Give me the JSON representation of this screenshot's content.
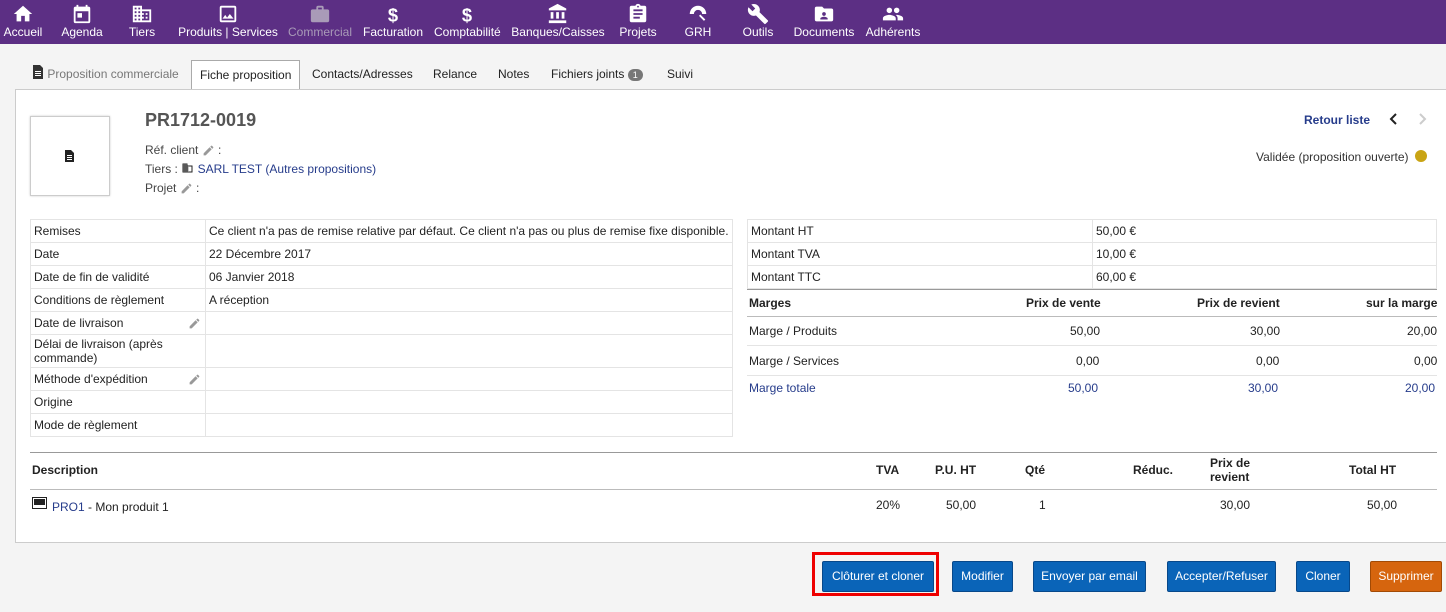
{
  "topnav": [
    {
      "label": "Accueil",
      "icon": "home-icon"
    },
    {
      "label": "Agenda",
      "icon": "calendar-icon"
    },
    {
      "label": "Tiers",
      "icon": "building-icon"
    },
    {
      "label": "Produits | Services",
      "icon": "image-icon"
    },
    {
      "label": "Commercial",
      "icon": "briefcase-icon"
    },
    {
      "label": "Facturation",
      "icon": "dollar-icon"
    },
    {
      "label": "Comptabilité",
      "icon": "dollar-icon"
    },
    {
      "label": "Banques/Caisses",
      "icon": "bank-icon"
    },
    {
      "label": "Projets",
      "icon": "clipboard-icon"
    },
    {
      "label": "GRH",
      "icon": "umbrella-icon"
    },
    {
      "label": "Outils",
      "icon": "wrench-icon"
    },
    {
      "label": "Documents",
      "icon": "folder-icon"
    },
    {
      "label": "Adhérents",
      "icon": "people-icon"
    }
  ],
  "tabs": {
    "t0": "Proposition commerciale",
    "t1": "Fiche proposition",
    "t2": "Contacts/Adresses",
    "t3": "Relance",
    "t4": "Notes",
    "t5": "Fichiers joints",
    "t5_badge": "1",
    "t6": "Suivi"
  },
  "header": {
    "ref": "PR1712-0019",
    "ref_client_label": "Réf. client",
    "colon": ":",
    "tiers_label": "Tiers :",
    "tiers_name": "SARL TEST",
    "tiers_other": "(Autres propositions)",
    "projet_label": "Projet",
    "retour": "Retour liste",
    "status": "Validée (proposition ouverte)",
    "status_color": "#c9a414"
  },
  "left_table": [
    {
      "label": "Remises",
      "value": "Ce client n'a pas de remise relative par défaut. Ce client n'a pas ou plus de remise fixe disponible."
    },
    {
      "label": "Date",
      "value": "22 Décembre 2017"
    },
    {
      "label": "Date de fin de validité",
      "value": "06 Janvier 2018"
    },
    {
      "label": "Conditions de règlement",
      "value": "A réception"
    },
    {
      "label": "Date de livraison",
      "value": ""
    },
    {
      "label": "Délai de livraison (après commande)",
      "value": ""
    },
    {
      "label": "Méthode d'expédition",
      "value": ""
    },
    {
      "label": "Origine",
      "value": ""
    },
    {
      "label": "Mode de règlement",
      "value": ""
    }
  ],
  "amounts": {
    "ht_label": "Montant HT",
    "ht": "50,00 €",
    "tva_label": "Montant TVA",
    "tva": "10,00 €",
    "ttc_label": "Montant TTC",
    "ttc": "60,00 €"
  },
  "margins": {
    "headers": [
      "Marges",
      "Prix de vente",
      "Prix de revient",
      "sur la marge"
    ],
    "rows": [
      {
        "label": "Marge / Produits",
        "pv": "50,00",
        "pr": "30,00",
        "m": "20,00"
      },
      {
        "label": "Marge / Services",
        "pv": "0,00",
        "pr": "0,00",
        "m": "0,00"
      },
      {
        "label": "Marge totale",
        "pv": "50,00",
        "pr": "30,00",
        "m": "20,00"
      }
    ]
  },
  "lines": {
    "headers": {
      "desc": "Description",
      "tva": "TVA",
      "pu": "P.U. HT",
      "qte": "Qté",
      "reduc": "Réduc.",
      "pr": "Prix de revient",
      "total": "Total HT"
    },
    "rows": [
      {
        "ref": "PRO1",
        "label": " - Mon produit 1",
        "tva": "20%",
        "pu": "50,00",
        "qte": "1",
        "reduc": "",
        "pr": "30,00",
        "total": "50,00"
      }
    ]
  },
  "buttons": {
    "close_clone": "Clôturer et cloner",
    "modify": "Modifier",
    "email": "Envoyer par email",
    "accept": "Accepter/Refuser",
    "clone": "Cloner",
    "delete": "Supprimer"
  }
}
